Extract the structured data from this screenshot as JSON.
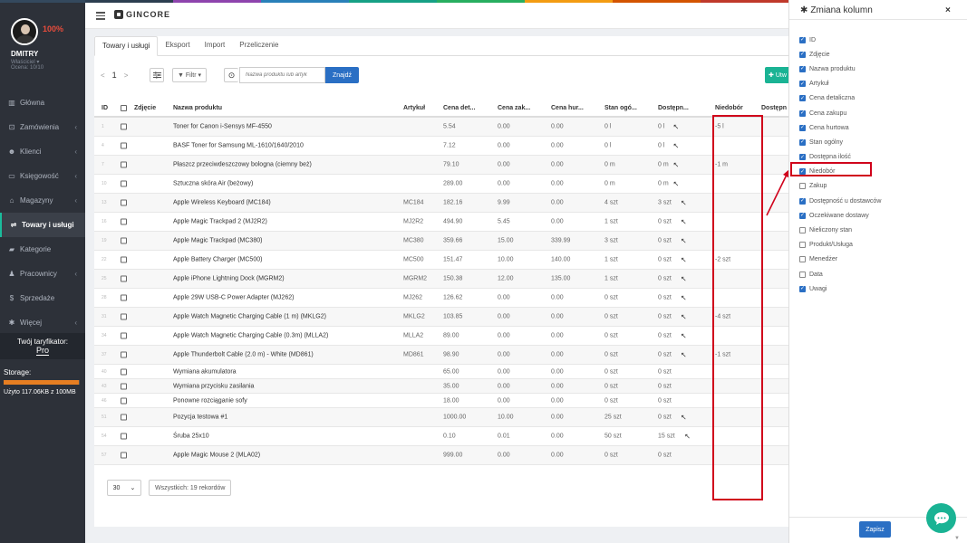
{
  "user": {
    "name": "DMITRY",
    "role": "Właściciel ▾",
    "score": "Ocena: 10/10",
    "progress": "100%"
  },
  "nav": [
    {
      "label": "Główna",
      "icon": "chart-icon",
      "glyph": "▥",
      "chev": false,
      "active": false
    },
    {
      "label": "Zamówienia",
      "icon": "cart-icon",
      "glyph": "⊡",
      "chev": true,
      "active": false
    },
    {
      "label": "Klienci",
      "icon": "users-icon",
      "glyph": "☻",
      "chev": true,
      "active": false
    },
    {
      "label": "Księgowość",
      "icon": "money-icon",
      "glyph": "▭",
      "chev": true,
      "active": false
    },
    {
      "label": "Magazyny",
      "icon": "warehouse-icon",
      "glyph": "⌂",
      "chev": true,
      "active": false
    },
    {
      "label": "Towary i usługi",
      "icon": "box-icon",
      "glyph": "⇌",
      "chev": false,
      "active": true
    },
    {
      "label": "Kategorie",
      "icon": "folder-icon",
      "glyph": "▰",
      "chev": false,
      "active": false
    },
    {
      "label": "Pracownicy",
      "icon": "user-icon",
      "glyph": "♟",
      "chev": true,
      "active": false
    },
    {
      "label": "Sprzedaże",
      "icon": "dollar-icon",
      "glyph": "$",
      "chev": false,
      "active": false
    },
    {
      "label": "Więcej",
      "icon": "gear-icon",
      "glyph": "✱",
      "chev": true,
      "active": false
    }
  ],
  "tariff": {
    "label": "Twój taryfikator:",
    "plan": "Pro"
  },
  "storage": {
    "label": "Storage:",
    "info": "Użyto 117.06KB z 100MB",
    "fill": 0.99
  },
  "brand": "GINCORE",
  "tabs": [
    "Towary i usługi",
    "Eksport",
    "Import",
    "Przeliczenie"
  ],
  "toolbar": {
    "prev": "<",
    "page": "1",
    "next": ">",
    "filter": "Filtr ▾",
    "search_placeholder": "Nazwa produktu lub artyk",
    "search_button": "Znajdź",
    "add_button": "Utw"
  },
  "columns": [
    "ID",
    "Zdjęcie",
    "Nazwa produktu",
    "Artykuł",
    "Cena det...",
    "Cena zak...",
    "Cena hur...",
    "Stan ogó...",
    "Dostępn...",
    "Niedobór",
    "Dostępn"
  ],
  "rows": [
    {
      "id": "1",
      "name": "Toner for Canon i-Sensys MF-4550",
      "art": "",
      "det": "5.54",
      "zak": "0.00",
      "hur": "0.00",
      "stan": "0 l",
      "dost": "0 l",
      "wand": true,
      "nied": "-5 l"
    },
    {
      "id": "4",
      "name": "BASF Toner for Samsung ML-1610/1640/2010",
      "art": "",
      "det": "7.12",
      "zak": "0.00",
      "hur": "0.00",
      "stan": "0 l",
      "dost": "0 l",
      "wand": true,
      "nied": ""
    },
    {
      "id": "7",
      "name": "Płaszcz przeciwdeszczowy bologna (ciemny beż)",
      "art": "",
      "det": "79.10",
      "zak": "0.00",
      "hur": "0.00",
      "stan": "0 m",
      "dost": "0 m",
      "wand": true,
      "nied": "-1 m"
    },
    {
      "id": "10",
      "name": "Sztuczna skóra Air (beżowy)",
      "art": "",
      "det": "289.00",
      "zak": "0.00",
      "hur": "0.00",
      "stan": "0 m",
      "dost": "0 m",
      "wand": true,
      "nied": ""
    },
    {
      "id": "13",
      "name": "Apple Wireless Keyboard (MC184)",
      "art": "MC184",
      "det": "182.16",
      "zak": "9.99",
      "hur": "0.00",
      "stan": "4 szt",
      "dost": "3 szt",
      "wand": true,
      "nied": ""
    },
    {
      "id": "16",
      "name": "Apple Magic Trackpad 2 (MJ2R2)",
      "art": "MJ2R2",
      "det": "494.90",
      "zak": "5.45",
      "hur": "0.00",
      "stan": "1 szt",
      "dost": "0 szt",
      "wand": true,
      "nied": ""
    },
    {
      "id": "19",
      "name": "Apple Magic Trackpad (MC380)",
      "art": "MC380",
      "det": "359.66",
      "zak": "15.00",
      "hur": "339.99",
      "stan": "3 szt",
      "dost": "0 szt",
      "wand": true,
      "nied": ""
    },
    {
      "id": "22",
      "name": "Apple Battery Charger (MC500)",
      "art": "MC500",
      "det": "151.47",
      "zak": "10.00",
      "hur": "140.00",
      "stan": "1 szt",
      "dost": "0 szt",
      "wand": true,
      "nied": "-2 szt"
    },
    {
      "id": "25",
      "name": "Apple iPhone Lightning Dock (MGRM2)",
      "art": "MGRM2",
      "det": "150.38",
      "zak": "12.00",
      "hur": "135.00",
      "stan": "1 szt",
      "dost": "0 szt",
      "wand": true,
      "nied": ""
    },
    {
      "id": "28",
      "name": "Apple 29W USB-C Power Adapter (MJ262)",
      "art": "MJ262",
      "det": "126.62",
      "zak": "0.00",
      "hur": "0.00",
      "stan": "0 szt",
      "dost": "0 szt",
      "wand": true,
      "nied": ""
    },
    {
      "id": "31",
      "name": "Apple Watch Magnetic Charging Cable (1 m) (MKLG2)",
      "art": "MKLG2",
      "det": "103.85",
      "zak": "0.00",
      "hur": "0.00",
      "stan": "0 szt",
      "dost": "0 szt",
      "wand": true,
      "nied": "-4 szt"
    },
    {
      "id": "34",
      "name": "Apple Watch Magnetic Charging Cable (0.3m) (MLLA2)",
      "art": "MLLA2",
      "det": "89.00",
      "zak": "0.00",
      "hur": "0.00",
      "stan": "0 szt",
      "dost": "0 szt",
      "wand": true,
      "nied": ""
    },
    {
      "id": "37",
      "name": "Apple Thunderbolt Cable (2.0 m) - White (MD861)",
      "art": "MD861",
      "det": "98.90",
      "zak": "0.00",
      "hur": "0.00",
      "stan": "0 szt",
      "dost": "0 szt",
      "wand": true,
      "nied": "-1 szt"
    },
    {
      "id": "40",
      "name": "Wymiana akumulatora",
      "art": "",
      "det": "65.00",
      "zak": "0.00",
      "hur": "0.00",
      "stan": "0 szt",
      "dost": "0 szt",
      "wand": false,
      "nied": ""
    },
    {
      "id": "43",
      "name": "Wymiana przycisku zasilania",
      "art": "",
      "det": "35.00",
      "zak": "0.00",
      "hur": "0.00",
      "stan": "0 szt",
      "dost": "0 szt",
      "wand": false,
      "nied": ""
    },
    {
      "id": "46",
      "name": "Ponowne rozciąganie sofy",
      "art": "",
      "det": "18.00",
      "zak": "0.00",
      "hur": "0.00",
      "stan": "0 szt",
      "dost": "0 szt",
      "wand": false,
      "nied": ""
    },
    {
      "id": "51",
      "name": "Pozycja testowa #1",
      "art": "",
      "det": "1000.00",
      "zak": "10.00",
      "hur": "0.00",
      "stan": "25 szt",
      "dost": "0 szt",
      "wand": true,
      "nied": ""
    },
    {
      "id": "54",
      "name": "Śruba 25x10",
      "art": "",
      "det": "0.10",
      "zak": "0.01",
      "hur": "0.00",
      "stan": "50 szt",
      "dost": "15 szt",
      "wand": true,
      "nied": ""
    },
    {
      "id": "57",
      "name": "Apple Magic Mouse 2 (MLA02)",
      "art": "",
      "det": "999.00",
      "zak": "0.00",
      "hur": "0.00",
      "stan": "0 szt",
      "dost": "0 szt",
      "wand": false,
      "nied": ""
    }
  ],
  "footer": {
    "per_page": "30",
    "total": "Wszystkich: 19 rekordów"
  },
  "panel": {
    "title": "Zmiana kolumn",
    "close": "×",
    "save": "Zapisz",
    "items": [
      {
        "label": "ID",
        "checked": true
      },
      {
        "label": "Zdjęcie",
        "checked": true
      },
      {
        "label": "Nazwa produktu",
        "checked": true
      },
      {
        "label": "Artykuł",
        "checked": true
      },
      {
        "label": "Cena detaliczna",
        "checked": true
      },
      {
        "label": "Cena zakupu",
        "checked": true
      },
      {
        "label": "Cena hurtowa",
        "checked": true
      },
      {
        "label": "Stan ogólny",
        "checked": true
      },
      {
        "label": "Dostępna ilość",
        "checked": true
      },
      {
        "label": "Niedobór",
        "checked": true
      },
      {
        "label": "Zakup",
        "checked": false
      },
      {
        "label": "Dostępność u dostawców",
        "checked": true
      },
      {
        "label": "Oczekiwane dostawy",
        "checked": true
      },
      {
        "label": "Nieliczony stan",
        "checked": false
      },
      {
        "label": "Produkt/Usługa",
        "checked": false
      },
      {
        "label": "Menedżer",
        "checked": false
      },
      {
        "label": "Data",
        "checked": false
      },
      {
        "label": "Uwagi",
        "checked": true
      }
    ]
  },
  "colors": {
    "accent": "#2a6fc4",
    "sidebar": "#2d3139",
    "highlight": "#d0021b",
    "green": "#1ab394",
    "orange": "#e67e22"
  }
}
